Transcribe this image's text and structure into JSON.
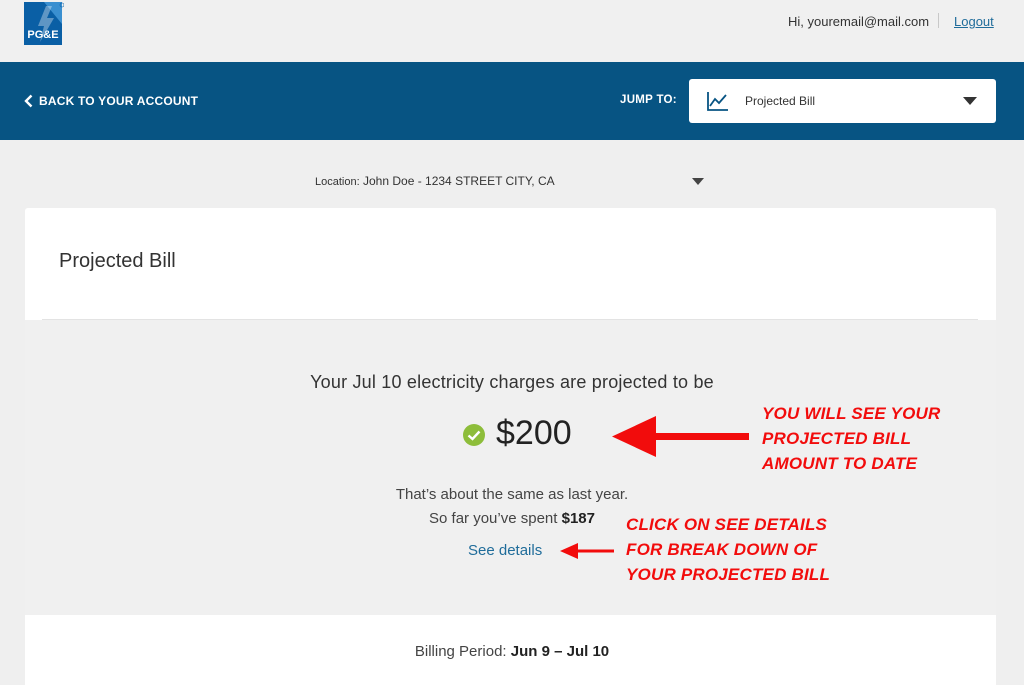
{
  "header": {
    "logo_text": "PG&E",
    "greeting": "Hi,  youremail@mail.com",
    "logout_label": "Logout"
  },
  "nav": {
    "back_label": "BACK TO YOUR ACCOUNT",
    "jump_label": "JUMP TO:",
    "jump_value": "Projected Bill"
  },
  "location": {
    "label": "Location:",
    "value": "John Doe - 1234 STREET CITY, CA"
  },
  "card": {
    "title": "Projected Bill",
    "projection_text": "Your Jul 10 electricity charges are projected to be",
    "amount": "$200",
    "comparison_text": "That’s about the same as last year.",
    "spent_prefix": "So far you’ve spent",
    "spent_amount": "$187",
    "details_link": "See details",
    "billing_label": "Billing Period:",
    "billing_value": "Jun 9 – Jul 10"
  },
  "annotations": {
    "amount_note": [
      "YOU WILL SEE YOUR",
      "PROJECTED BILL",
      "AMOUNT TO DATE"
    ],
    "details_note": [
      "CLICK ON SEE DETAILS",
      "FOR BREAK DOWN OF",
      "YOUR PROJECTED BILL"
    ]
  },
  "colors": {
    "brand_blue": "#075483",
    "link_blue": "#1f6c9a",
    "status_green": "#8dbd3a",
    "annotation_red": "#f20c0c"
  },
  "icons": {
    "logo": "pge-logo-icon",
    "back": "chevron-left-icon",
    "jump": "line-chart-icon",
    "jump_caret": "caret-down-icon",
    "location_caret": "caret-down-icon",
    "status": "check-circle-icon"
  }
}
